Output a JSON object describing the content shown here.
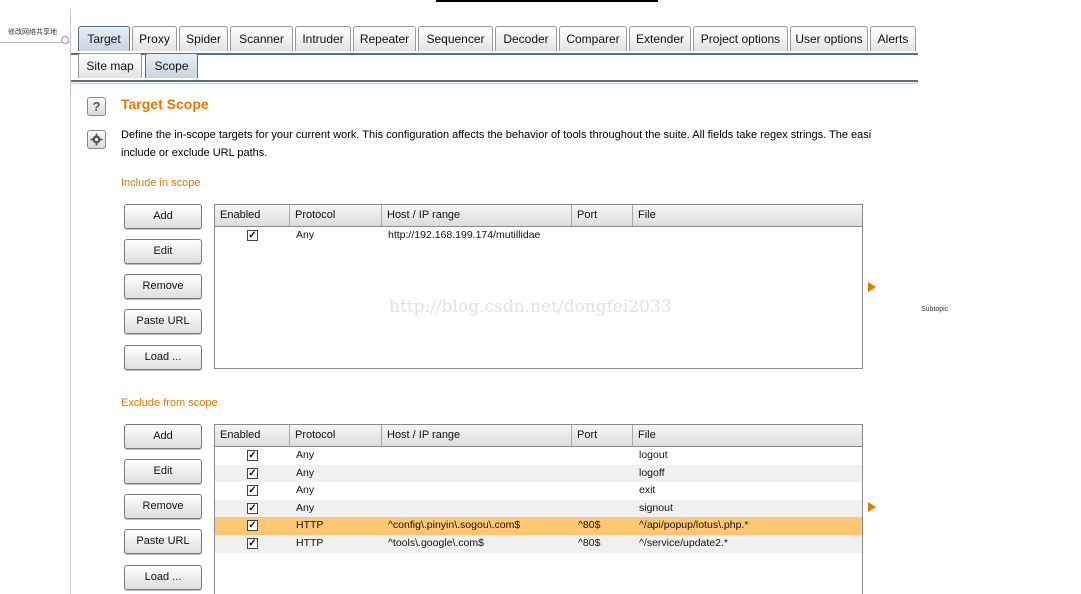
{
  "side_panel": {
    "label": "修改网络共享地"
  },
  "subtopic": "Subtopic",
  "tabs": [
    "Target",
    "Proxy",
    "Spider",
    "Scanner",
    "Intruder",
    "Repeater",
    "Sequencer",
    "Decoder",
    "Comparer",
    "Extender",
    "Project options",
    "User options",
    "Alerts"
  ],
  "subtabs": [
    "Site map",
    "Scope"
  ],
  "icons": {
    "help": "question-mark-icon",
    "settings": "gear-icon"
  },
  "page": {
    "title": "Target Scope",
    "description_line1": "Define the in-scope targets for your current work. This configuration affects the behavior of tools throughout the suite. All fields take regex strings. The easi",
    "description_line2": "include or exclude URL paths."
  },
  "columns": [
    "Enabled",
    "Protocol",
    "Host / IP range",
    "Port",
    "File"
  ],
  "include": {
    "heading": "Include in scope",
    "buttons": [
      "Add",
      "Edit",
      "Remove",
      "Paste URL",
      "Load ..."
    ],
    "rows": [
      {
        "enabled": true,
        "protocol": "Any",
        "host": "http://192.168.199.174/mutillidae",
        "port": "",
        "file": ""
      }
    ]
  },
  "exclude": {
    "heading": "Exclude from scope",
    "buttons": [
      "Add",
      "Edit",
      "Remove",
      "Paste URL",
      "Load ..."
    ],
    "selected_row": 4,
    "rows": [
      {
        "enabled": true,
        "protocol": "Any",
        "host": "",
        "port": "",
        "file": "logout"
      },
      {
        "enabled": true,
        "protocol": "Any",
        "host": "",
        "port": "",
        "file": "logoff"
      },
      {
        "enabled": true,
        "protocol": "Any",
        "host": "",
        "port": "",
        "file": "exit"
      },
      {
        "enabled": true,
        "protocol": "Any",
        "host": "",
        "port": "",
        "file": "signout"
      },
      {
        "enabled": true,
        "protocol": "HTTP",
        "host": "^config\\.pinyin\\.sogou\\.com$",
        "port": "^80$",
        "file": "^/api/popup/lotus\\.php.*"
      },
      {
        "enabled": true,
        "protocol": "HTTP",
        "host": "^tools\\.google\\.com$",
        "port": "^80$",
        "file": "^/service/update2.*"
      }
    ]
  },
  "watermark": "http://blog.csdn.net/dongfei2033",
  "colors": {
    "accent": "#e07b00",
    "selection": "#ffc674",
    "tab_border": "#5a6e8a"
  }
}
